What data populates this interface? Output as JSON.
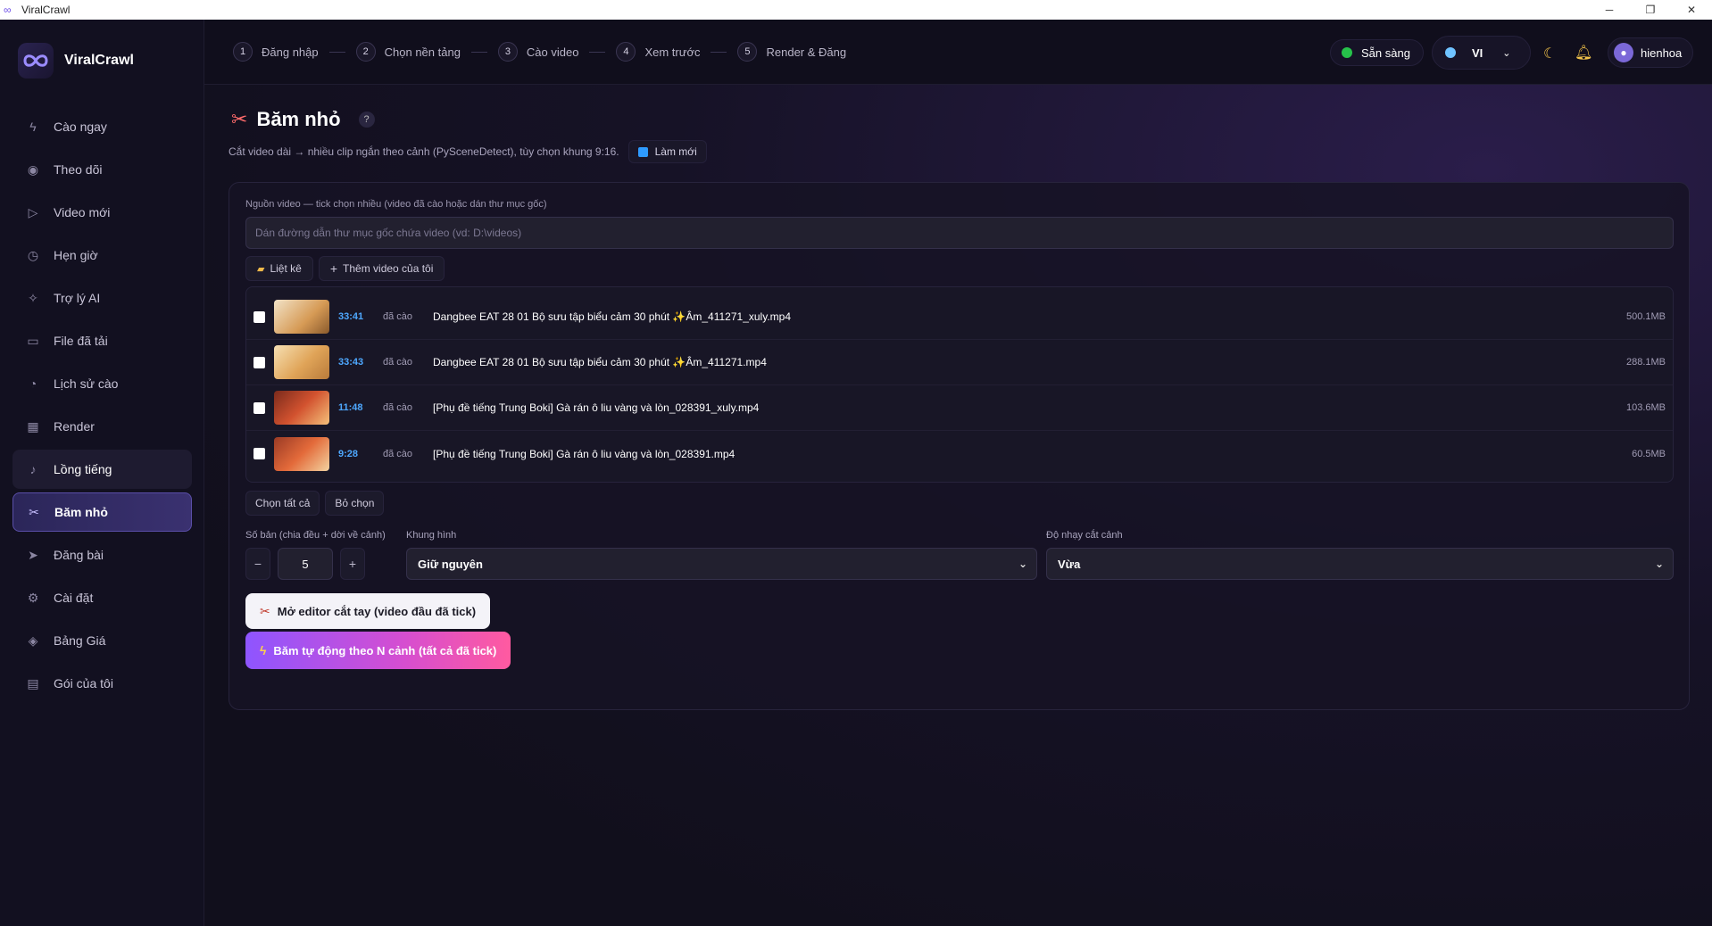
{
  "window": {
    "title": "ViralCrawl",
    "controls": {
      "minimize": "─",
      "restore": "❐",
      "close": "✕"
    }
  },
  "brand": {
    "name": "ViralCrawl"
  },
  "sidebar": {
    "items": [
      {
        "label": "Cào ngay",
        "icon": "bolt-icon",
        "glyph": "ϟ"
      },
      {
        "label": "Theo dõi",
        "icon": "eye-icon",
        "glyph": "◉"
      },
      {
        "label": "Video mới",
        "icon": "play-icon",
        "glyph": "▷"
      },
      {
        "label": "Hẹn giờ",
        "icon": "clock-icon",
        "glyph": "◷"
      },
      {
        "label": "Trợ lý AI",
        "icon": "sparkle-icon",
        "glyph": "✧"
      },
      {
        "label": "File đã tải",
        "icon": "folder-icon",
        "glyph": "▭"
      },
      {
        "label": "Lịch sử cào",
        "icon": "history-icon",
        "glyph": "◔"
      },
      {
        "label": "Render",
        "icon": "film-icon",
        "glyph": "▦"
      },
      {
        "label": "Lồng tiếng",
        "icon": "mic-icon",
        "glyph": "♪"
      },
      {
        "label": "Băm nhỏ",
        "icon": "scissors-icon",
        "glyph": "✂"
      },
      {
        "label": "Đăng bài",
        "icon": "send-icon",
        "glyph": "➤"
      },
      {
        "label": "Cài đặt",
        "icon": "gear-icon",
        "glyph": "⚙"
      },
      {
        "label": "Bảng Giá",
        "icon": "tag-icon",
        "glyph": "◈"
      },
      {
        "label": "Gói của tôi",
        "icon": "package-icon",
        "glyph": "▤"
      }
    ],
    "active_index": 9,
    "hover_index": 8
  },
  "topbar": {
    "steps": [
      {
        "num": "1",
        "label": "Đăng nhập"
      },
      {
        "num": "2",
        "label": "Chọn nền tảng"
      },
      {
        "num": "3",
        "label": "Cào video"
      },
      {
        "num": "4",
        "label": "Xem trước"
      },
      {
        "num": "5",
        "label": "Render & Đăng"
      }
    ],
    "status": "Sẵn sàng",
    "language": "VI",
    "username": "hienhoa"
  },
  "page": {
    "title": "Băm nhỏ",
    "help": "?",
    "subtitle": "Cắt video dài → nhiều clip ngắn theo cảnh (PySceneDetect), tùy chọn khung 9:16.",
    "refresh_label": "Làm mới"
  },
  "source": {
    "label": "Nguồn video — tick chọn nhiều (video đã cào hoặc dán thư mục gốc)",
    "path_placeholder": "Dán đường dẫn thư mục gốc chứa video (vd: D:\\videos)",
    "path_value": "",
    "list_label": "Liệt kê",
    "add_label": "Thêm video của tôi"
  },
  "videos": [
    {
      "duration": "33:41",
      "status": "đã cào",
      "name": "Dangbee EAT 28 01 Bộ sưu tập biểu cảm 30 phút ✨Âm_411271_xuly.mp4",
      "size": "500.1MB",
      "checked": false
    },
    {
      "duration": "33:43",
      "status": "đã cào",
      "name": "Dangbee EAT 28 01 Bộ sưu tập biểu cảm 30 phút ✨Âm_411271.mp4",
      "size": "288.1MB",
      "checked": false
    },
    {
      "duration": "11:48",
      "status": "đã cào",
      "name": "[Phụ đề tiếng Trung Boki] Gà rán ô liu vàng và lòn_028391_xuly.mp4",
      "size": "103.6MB",
      "checked": false
    },
    {
      "duration": "9:28",
      "status": "đã cào",
      "name": "[Phụ đề tiếng Trung Boki] Gà rán ô liu vàng và lòn_028391.mp4",
      "size": "60.5MB",
      "checked": false
    }
  ],
  "selection": {
    "select_all": "Chọn tất cả",
    "deselect": "Bỏ chọn"
  },
  "options": {
    "count_label": "Số bản (chia đều + dời về cảnh)",
    "count_value": "5",
    "minus": "−",
    "plus": "+",
    "frame_label": "Khung hình",
    "frame_value": "Giữ nguyên",
    "sensitivity_label": "Độ nhạy cắt cảnh",
    "sensitivity_value": "Vừa"
  },
  "actions": {
    "editor_label": "Mở editor cắt tay (video đầu đã tick)",
    "auto_label": "Băm tự động theo N cảnh (tất cả đã tick)"
  },
  "colors": {
    "accent": "#8e55ff",
    "status_ok": "#26c24a",
    "duration": "#4ea8ff"
  }
}
